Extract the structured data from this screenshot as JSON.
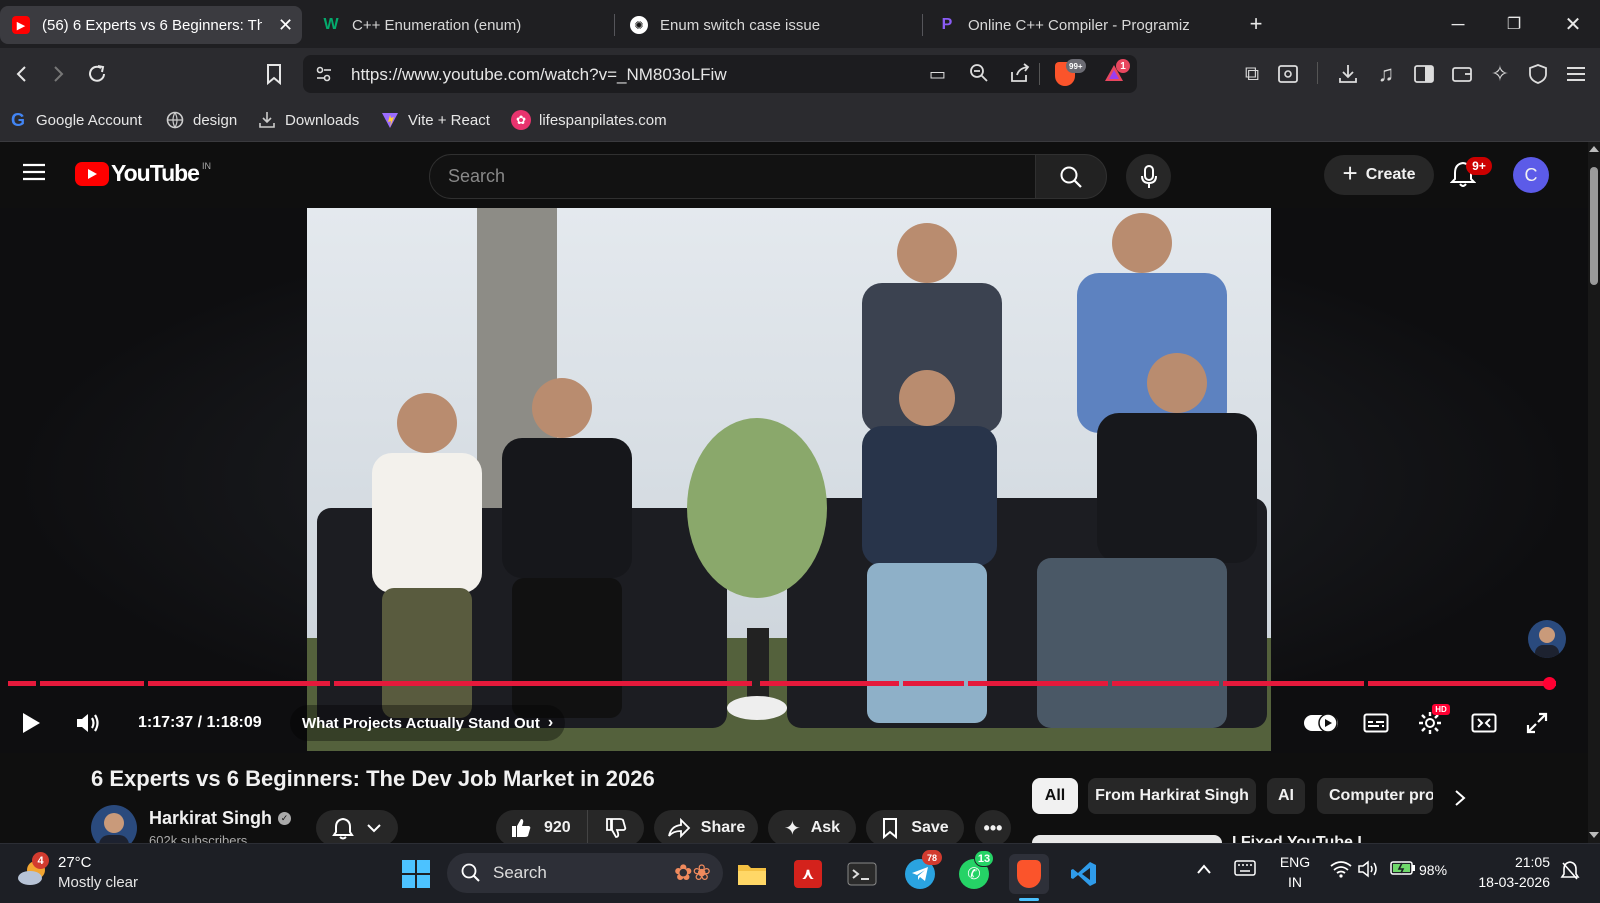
{
  "browser": {
    "tabs": [
      {
        "title": "(56) 6 Experts vs 6 Beginners: The",
        "favicon": "youtube-icon"
      },
      {
        "title": "C++ Enumeration (enum)",
        "favicon": "w3schools-icon"
      },
      {
        "title": "Enum switch case issue",
        "favicon": "chatgpt-icon"
      },
      {
        "title": "Online C++ Compiler - Programiz",
        "favicon": "programiz-icon"
      }
    ],
    "url": "https://www.youtube.com/watch?v=_NM803oLFiw",
    "shield_badge": "99+",
    "rewards_badge": "1",
    "bookmarks": [
      {
        "label": "Google Account",
        "icon": "google-icon"
      },
      {
        "label": "design",
        "icon": "globe-icon"
      },
      {
        "label": "Downloads",
        "icon": "download-icon"
      },
      {
        "label": "Vite + React",
        "icon": "vite-icon"
      },
      {
        "label": "lifespanpilates.com",
        "icon": "flower-icon"
      }
    ]
  },
  "youtube": {
    "logo_text": "YouTube",
    "country": "IN",
    "search_placeholder": "Search",
    "create_label": "Create",
    "notif_badge": "9+",
    "avatar_letter": "C",
    "player": {
      "time": "1:17:37 / 1:18:09",
      "chapter": "What Projects Actually Stand Out",
      "hd_badge": "HD",
      "progress_fraction": 0.993
    },
    "video": {
      "title": "6 Experts vs 6 Beginners: The Dev Job Market in 2026",
      "channel": "Harkirat Singh",
      "subscribers": "602k subscribers",
      "likes": "920",
      "share_label": "Share",
      "ask_label": "Ask",
      "save_label": "Save"
    },
    "chips": [
      "All",
      "From Harkirat Singh",
      "AI",
      "Computer pro"
    ],
    "next_video_title_partial": "I Fixed YouTube I"
  },
  "taskbar": {
    "weather_temp": "27°C",
    "weather_desc": "Mostly clear",
    "weather_badge": "4",
    "search_label": "Search",
    "telegram_badge": "78",
    "whatsapp_badge": "13",
    "lang_top": "ENG",
    "lang_bottom": "IN",
    "battery": "98%",
    "time": "21:05",
    "date": "18-03-2026"
  }
}
